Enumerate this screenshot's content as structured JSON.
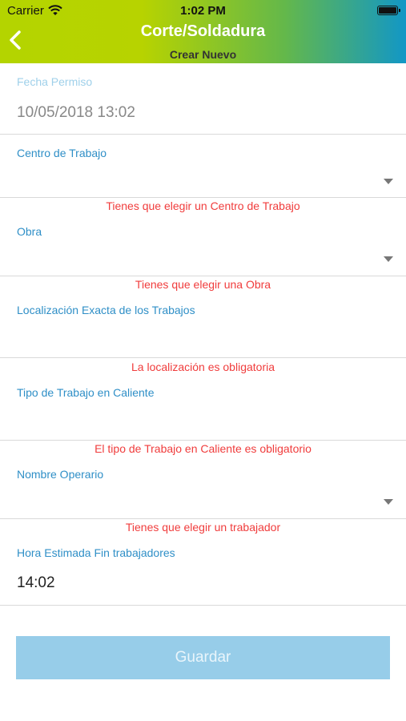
{
  "status_bar": {
    "carrier": "Carrier",
    "time": "1:02 PM",
    "icons": [
      "wifi-icon",
      "battery-icon"
    ]
  },
  "header": {
    "title": "Corte/Soldadura",
    "subtitle": "Crear Nuevo",
    "back_icon": "chevron-left-icon",
    "gradient_colors": [
      "#b4d400",
      "#64b84a",
      "#1297c6"
    ]
  },
  "form": {
    "fecha_permiso": {
      "label": "Fecha Permiso",
      "value": "10/05/2018 13:02"
    },
    "centro_trabajo": {
      "label": "Centro de Trabajo",
      "error": "Tienes que elegir un Centro de Trabajo"
    },
    "obra": {
      "label": "Obra",
      "error": "Tienes que elegir una Obra"
    },
    "localizacion": {
      "label": "Localización Exacta de los Trabajos",
      "error": "La localización es obligatoria"
    },
    "tipo_trabajo": {
      "label": "Tipo de Trabajo en Caliente",
      "error": "El tipo de Trabajo en Caliente es obligatorio"
    },
    "nombre_operario": {
      "label": "Nombre Operario",
      "error": "Tienes que elegir un trabajador"
    },
    "hora_estimada": {
      "label": "Hora Estimada Fin trabajadores",
      "value": "14:02"
    }
  },
  "actions": {
    "save_label": "Guardar",
    "save_color": "#97cde9"
  },
  "colors": {
    "label": "#2f8fc7",
    "error": "#f03c3c"
  }
}
